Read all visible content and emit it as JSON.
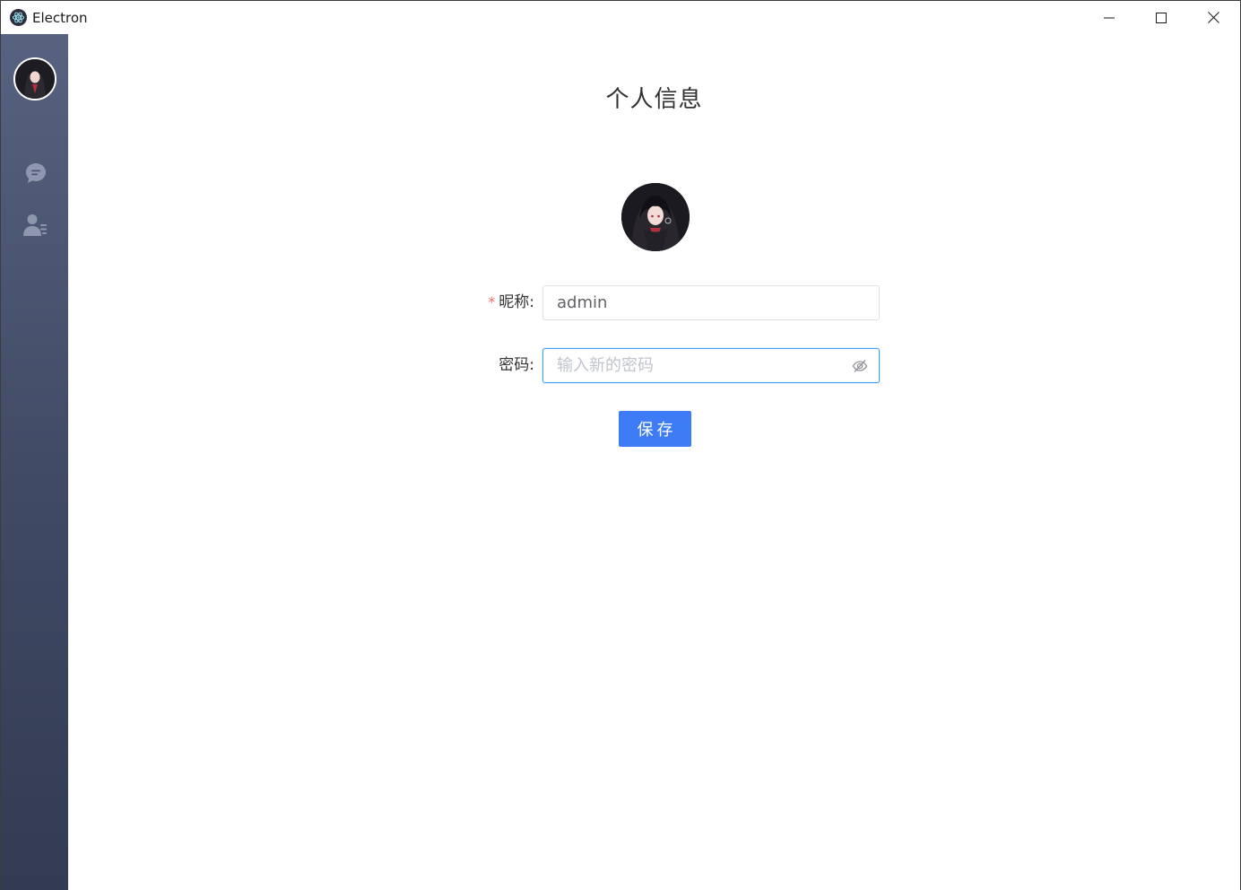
{
  "window": {
    "title": "Electron",
    "icon": "electron-icon",
    "controls": [
      "minimize-icon",
      "maximize-icon",
      "close-icon"
    ]
  },
  "sidebar": {
    "avatar": "user-avatar",
    "items": [
      {
        "name": "chat",
        "icon": "chat-bubble-icon"
      },
      {
        "name": "contacts",
        "icon": "contacts-icon"
      }
    ]
  },
  "main": {
    "title": "个人信息",
    "form": {
      "nickname_label": "昵称:",
      "nickname_required_mark": "*",
      "nickname_value": "admin",
      "password_label": "密码:",
      "password_value": "",
      "password_placeholder": "输入新的密码",
      "save_label": "保存"
    }
  },
  "colors": {
    "sidebar_top": "#56627f",
    "sidebar_bottom": "#333b52",
    "primary": "#3d7cf5",
    "required": "#f56c6c",
    "focus_border": "#409eff"
  }
}
